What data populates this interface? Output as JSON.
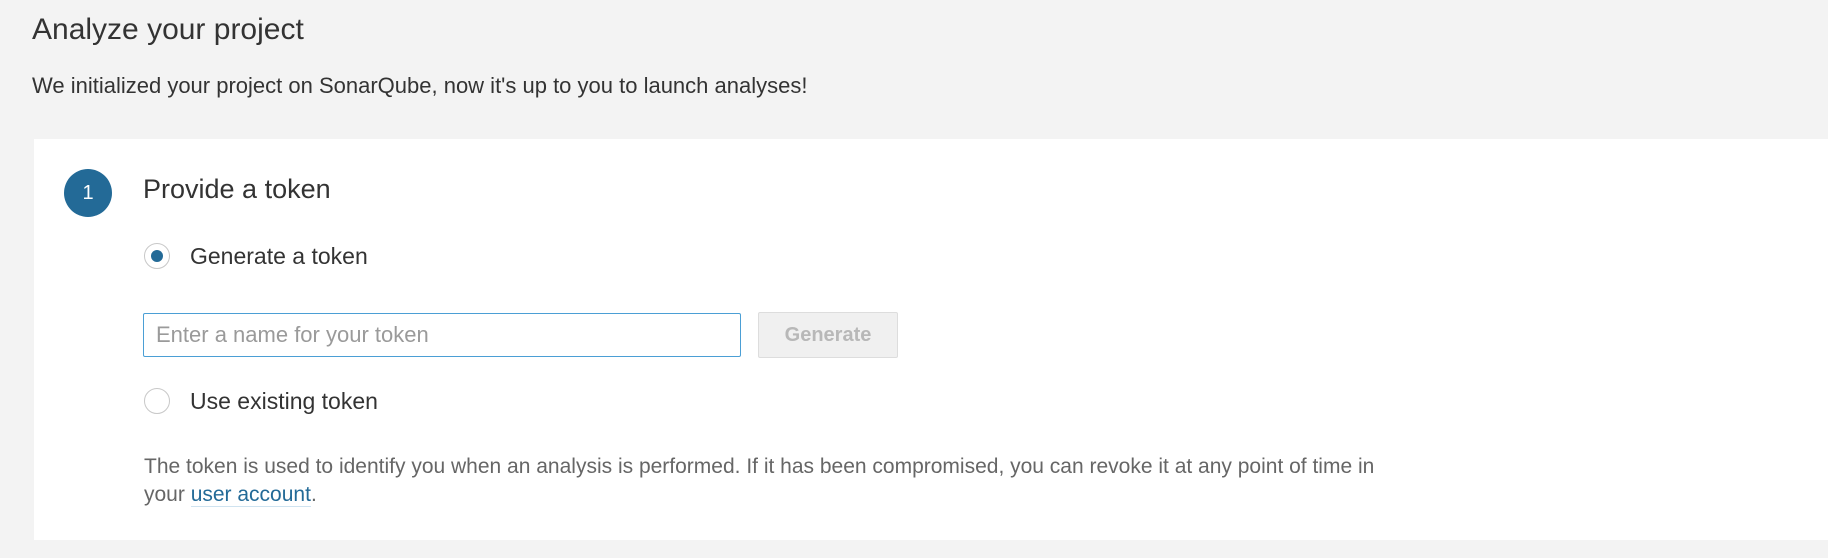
{
  "header": {
    "title": "Analyze your project",
    "subtitle": "We initialized your project on SonarQube, now it's up to you to launch analyses!"
  },
  "step": {
    "number": "1",
    "title": "Provide a token",
    "options": {
      "generate_label": "Generate a token",
      "generate_selected": true,
      "existing_label": "Use existing token",
      "existing_selected": false
    },
    "token_input": {
      "value": "",
      "placeholder": "Enter a name for your token"
    },
    "generate_button_label": "Generate",
    "help": {
      "text_before": "The token is used to identify you when an analysis is performed. If it has been compromised, you can revoke it at any point of time in your ",
      "link_text": "user account",
      "text_after": "."
    }
  },
  "colors": {
    "accent": "#236a97",
    "background": "#f3f3f3",
    "card": "#ffffff",
    "muted_text": "#666666"
  }
}
